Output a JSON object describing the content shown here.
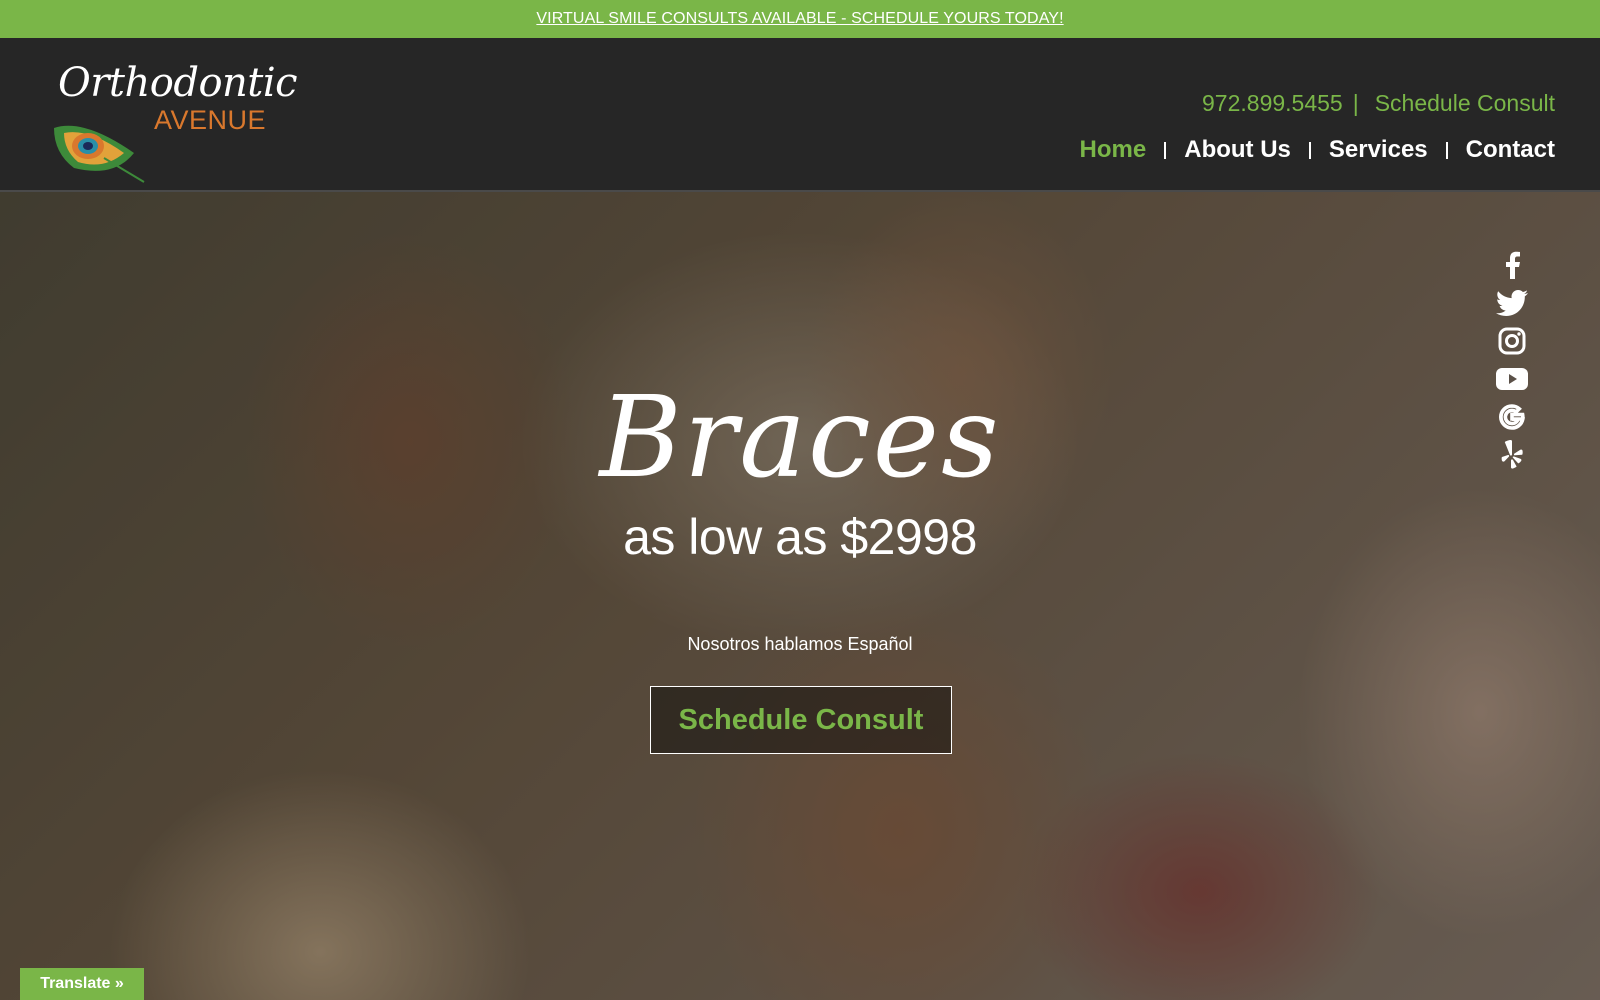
{
  "announcement": {
    "text": "VIRTUAL SMILE CONSULTS AVAILABLE - SCHEDULE YOURS TODAY!"
  },
  "logo": {
    "script": "Orthodontic",
    "sub": "AVENUE"
  },
  "header": {
    "phone": "972.899.5455",
    "separator": "|",
    "schedule_link": "Schedule Consult"
  },
  "nav": {
    "items": [
      {
        "label": "Home",
        "active": true
      },
      {
        "label": "About Us"
      },
      {
        "label": "Services"
      },
      {
        "label": "Contact"
      }
    ]
  },
  "social": [
    "facebook-icon",
    "twitter-icon",
    "instagram-icon",
    "youtube-icon",
    "google-icon",
    "yelp-icon"
  ],
  "hero": {
    "headline": "Braces",
    "subheadline": "as low as $2998",
    "spanish_note": "Nosotros hablamos Español",
    "cta_label": "Schedule Consult"
  },
  "translate": {
    "label": "Translate »"
  },
  "colors": {
    "accent": "#7ab648",
    "header_bg": "#262626",
    "logo_orange": "#d9782d"
  }
}
